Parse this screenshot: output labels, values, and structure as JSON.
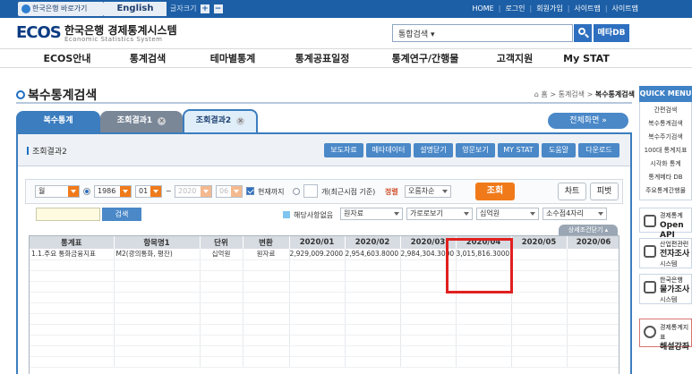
{
  "topbar": {
    "bok_link": "한국은행 바로가기",
    "english": "English",
    "font_size_label": "글자크기",
    "font_plus": "+",
    "font_minus": "−",
    "links": [
      "HOME",
      "로그인",
      "회원가입",
      "사이트맵",
      "사이트맵"
    ]
  },
  "header": {
    "logo": "ECOS",
    "title_ko": "한국은행 경제통계시스템",
    "title_en": "Economic Statistics System",
    "search_select": "통합검색",
    "metadb": "메타DB"
  },
  "nav": [
    "ECOS안내",
    "통계검색",
    "테마별통계",
    "통계공표일정",
    "통계연구/간행물",
    "고객지원",
    "My STAT"
  ],
  "page": {
    "title": "복수통계검색",
    "breadcrumb_home": "홈",
    "breadcrumb_mid": "통계검색",
    "breadcrumb_current": "복수통계검색"
  },
  "quick_menu": {
    "title": "QUICK MENU",
    "items": [
      "간편검색",
      "복수통계검색",
      "복수주기검색",
      "100대 통계지표",
      "시각화 통계",
      "통계메타 DB",
      "주요통계간행물"
    ],
    "open_api_small": "경제통계",
    "open_api": "Open API",
    "biz_survey_small": "산업편관련",
    "biz_survey": "전자조사",
    "biz_survey_sub": "시스템",
    "price_survey_small": "한국은행",
    "price_survey": "물가조사",
    "price_survey_sub": "시스템",
    "lecture_small": "경제통계지표",
    "lecture": "해설강좌"
  },
  "tabs": {
    "multi": "복수통계",
    "result1": "조회결과1",
    "result2": "조회결과2",
    "close": "×",
    "fullscreen": "전체화면"
  },
  "panel": {
    "label": "조회결과2",
    "buttons": [
      "보도자료",
      "메타데이터",
      "설명닫기",
      "영문보기",
      "MY STAT",
      "도움말",
      "다운로드"
    ]
  },
  "controls": {
    "period": "월",
    "start_year": "1986",
    "start_month": "01",
    "tilde": "~",
    "end_year": "2020",
    "end_month": "06",
    "current_label": "현재까지",
    "recent_label": "개(최근시점 기준)",
    "sort_label": "정렬",
    "sort_value": "오름차순",
    "query": "조회",
    "chart": "차트",
    "pivot": "피벗",
    "filter_btn": "검색",
    "na_label": "해당사항없음",
    "data_type": "원자료",
    "layout": "가로로보기",
    "unit": "십억원",
    "decimals": "소수점4자리",
    "detail": "상세조건닫기"
  },
  "table": {
    "headers": [
      "통계표",
      "항목명1",
      "단위",
      "변환",
      "2020/01",
      "2020/02",
      "2020/03",
      "2020/04",
      "2020/05",
      "2020/06"
    ],
    "rows": [
      [
        "1.1.주요 통화금융지표",
        "M2(광의통화, 평잔)",
        "십억원",
        "원자료",
        "2,929,009.2000",
        "2,954,603.8000",
        "2,984,304.3000",
        "3,015,816.3000",
        "",
        ""
      ]
    ]
  },
  "colors": {
    "topbar": "#1d5fa6",
    "accent": "#3b7dbf",
    "query_button": "#f07a1a",
    "highlight": "#e0201f"
  }
}
